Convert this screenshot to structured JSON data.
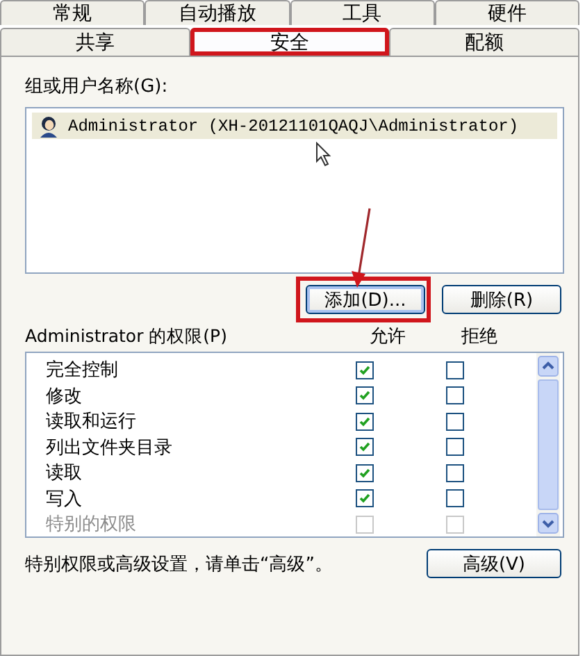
{
  "tabs_row_1": [
    {
      "label": "常规",
      "selected": false,
      "highlighted": false
    },
    {
      "label": "自动播放",
      "selected": false,
      "highlighted": false
    },
    {
      "label": "工具",
      "selected": false,
      "highlighted": false
    },
    {
      "label": "硬件",
      "selected": false,
      "highlighted": false
    }
  ],
  "tabs_row_2": [
    {
      "label": "共享",
      "selected": false,
      "highlighted": false
    },
    {
      "label": "安全",
      "selected": true,
      "highlighted": true
    },
    {
      "label": "配额",
      "selected": false,
      "highlighted": false
    }
  ],
  "users": {
    "label": "组或用户名称(G):",
    "items": [
      {
        "name": "Administrator (XH-20121101QAQJ\\Administrator)",
        "selected": true
      }
    ]
  },
  "user_buttons": [
    {
      "label": "添加(D)...",
      "highlighted": true,
      "focused": true
    },
    {
      "label": "删除(R)",
      "highlighted": false,
      "focused": false
    }
  ],
  "annotation_arrow": true,
  "permissions": {
    "label": "Administrator 的权限(P)",
    "column_allow": "允许",
    "column_deny": "拒绝",
    "rows": [
      {
        "name": "完全控制",
        "allow": true,
        "deny": false,
        "disabled": false
      },
      {
        "name": "修改",
        "allow": true,
        "deny": false,
        "disabled": false
      },
      {
        "name": "读取和运行",
        "allow": true,
        "deny": false,
        "disabled": false
      },
      {
        "name": "列出文件夹目录",
        "allow": true,
        "deny": false,
        "disabled": false
      },
      {
        "name": "读取",
        "allow": true,
        "deny": false,
        "disabled": false
      },
      {
        "name": "写入",
        "allow": true,
        "deny": false,
        "disabled": false
      },
      {
        "name": "特别的权限",
        "allow": false,
        "deny": false,
        "disabled": true
      }
    ]
  },
  "advanced_hint": "特别权限或高级设置，请单击“高级”。",
  "advanced_button": "高级(V)"
}
